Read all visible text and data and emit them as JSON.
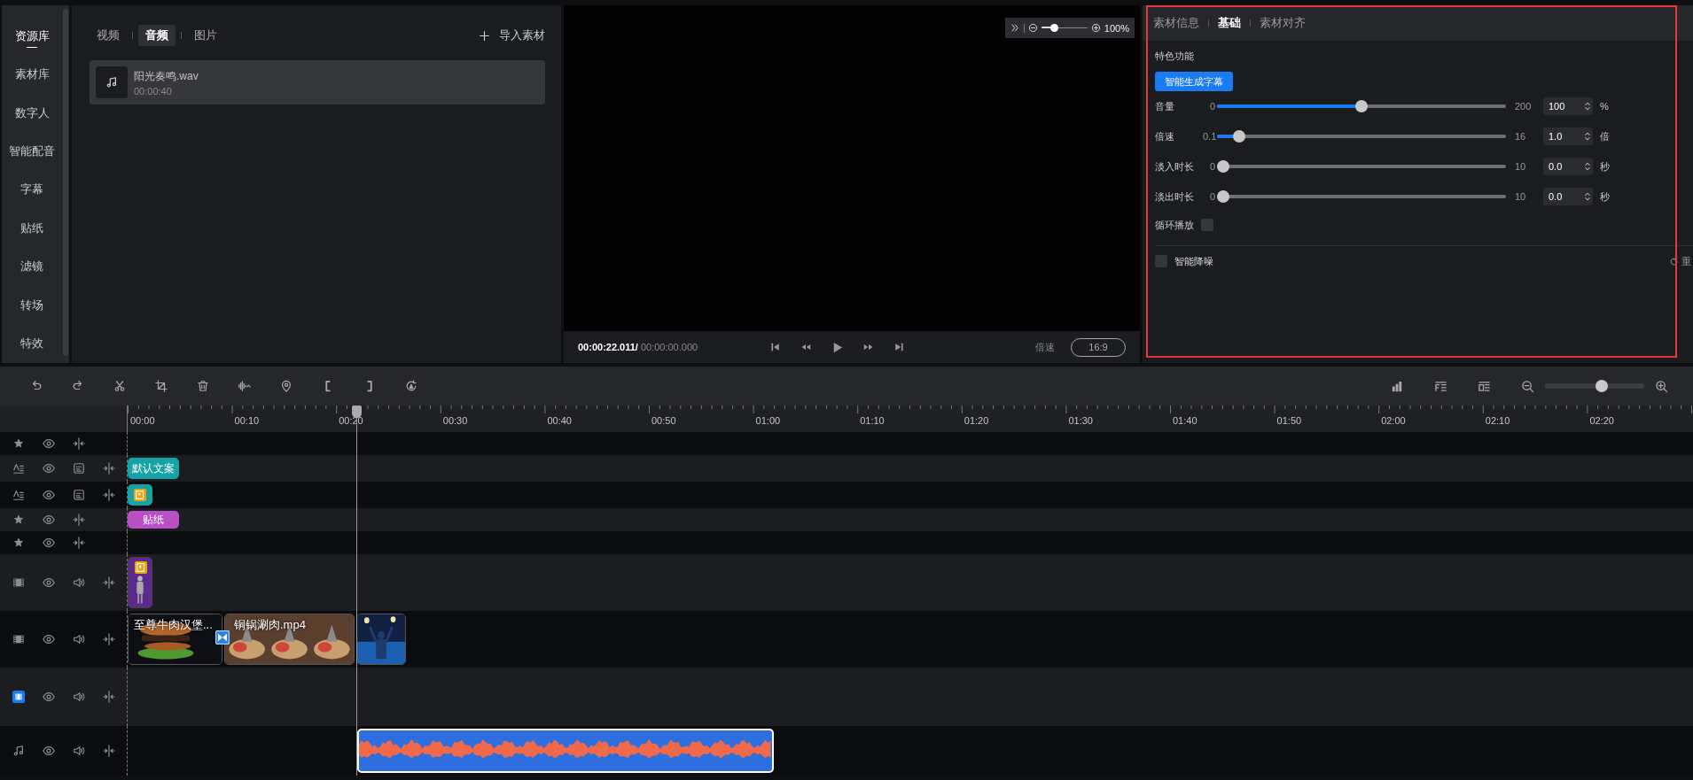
{
  "sidebar": {
    "items": [
      {
        "label": "资源库",
        "selected": true
      },
      {
        "label": "素材库",
        "selected": false
      },
      {
        "label": "数字人",
        "selected": false
      },
      {
        "label": "智能配音",
        "selected": false
      },
      {
        "label": "字幕",
        "selected": false
      },
      {
        "label": "贴纸",
        "selected": false
      },
      {
        "label": "滤镜",
        "selected": false
      },
      {
        "label": "转场",
        "selected": false
      },
      {
        "label": "特效",
        "selected": false
      }
    ]
  },
  "library": {
    "tabs": [
      {
        "label": "视频",
        "selected": false
      },
      {
        "label": "音频",
        "selected": true
      },
      {
        "label": "图片",
        "selected": false
      }
    ],
    "import_button": "导入素材",
    "items": [
      {
        "name": "阳光奏鸣.wav",
        "duration": "00:00:40"
      }
    ]
  },
  "preview": {
    "zoom": {
      "level": 0.24,
      "reading": "100%"
    },
    "current_time": "00:00:22.011/",
    "total_time": "00:00:00.000",
    "speed_label": "倍速",
    "ratio_button": "16:9"
  },
  "properties": {
    "tabs": [
      {
        "label": "素材信息",
        "selected": false
      },
      {
        "label": "基础",
        "selected": true
      },
      {
        "label": "素材对齐",
        "selected": false
      }
    ],
    "section_title": "特色功能",
    "action_button": "智能生成字幕",
    "sliders": [
      {
        "label": "音量",
        "min": "0",
        "max": "200",
        "level": 0.5,
        "value": "100",
        "unit": "%"
      },
      {
        "label": "倍速",
        "min": "0.1",
        "max": "16",
        "level": 0.057,
        "value": "1.0",
        "unit": "倍"
      },
      {
        "label": "淡入时长",
        "min": "0",
        "max": "10",
        "level": 0,
        "value": "0.0",
        "unit": "秒"
      },
      {
        "label": "淡出时长",
        "min": "0",
        "max": "10",
        "level": 0,
        "value": "0.0",
        "unit": "秒"
      }
    ],
    "loop": {
      "label": "循环播放",
      "checked": false
    },
    "denoise": {
      "label": "智能降噪",
      "checked": false
    },
    "reset_button": "重"
  },
  "timeline": {
    "zoom": {
      "level": 0.58
    },
    "ruler": [
      "00:00",
      "00:10",
      "00:20",
      "00:30",
      "00:40",
      "00:50",
      "01:00",
      "01:10",
      "01:20",
      "01:30",
      "01:40",
      "01:50",
      "02:00",
      "02:10",
      "02:20"
    ],
    "tracks": [
      {
        "kind": "sticker"
      },
      {
        "kind": "text",
        "clips": [
          {
            "kind": "text",
            "label": "默认文案",
            "selected": false
          }
        ]
      },
      {
        "kind": "text",
        "clips": [
          {
            "kind": "subtitle",
            "selected": false
          }
        ]
      },
      {
        "kind": "sticker",
        "clips": [
          {
            "kind": "sticker",
            "label": "贴纸",
            "selected": false
          }
        ]
      },
      {
        "kind": "sticker"
      },
      {
        "kind": "video",
        "clips": [
          {
            "kind": "avatar",
            "selected": false
          }
        ]
      },
      {
        "kind": "video",
        "clips": [
          {
            "kind": "video",
            "label": "至尊牛肉汉堡...",
            "transition": true,
            "selected": false
          },
          {
            "kind": "video",
            "label": "铜锅涮肉.mp4",
            "transition": false,
            "selected": false
          },
          {
            "kind": "video",
            "transition": false,
            "selected": false
          }
        ]
      },
      {
        "kind": "main"
      },
      {
        "kind": "audio",
        "clips": [
          {
            "kind": "audio",
            "selected": true
          }
        ]
      }
    ]
  }
}
